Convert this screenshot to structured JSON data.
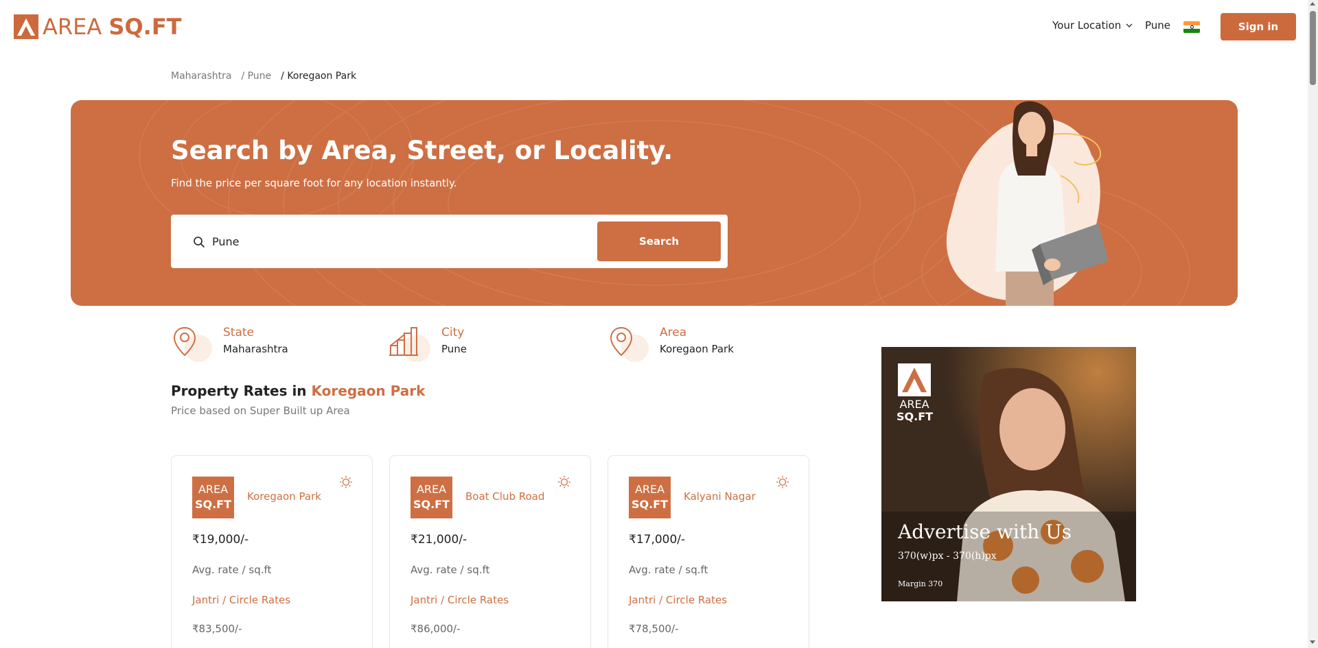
{
  "brand": {
    "name_light": "AREA ",
    "name_bold": "SQ.FT",
    "accent_color": "#cd6f43"
  },
  "header": {
    "location_label": "Your Location",
    "city": "Pune",
    "flag_icon": "india-flag-icon",
    "signin_label": "Sign in"
  },
  "breadcrumb": {
    "items": [
      "Maharashtra",
      "/ Pune",
      "/ Koregaon Park"
    ]
  },
  "hero": {
    "title": "Search by Area, Street, or Locality.",
    "subtitle": "Find the price per square foot for any location instantly.",
    "search_value": "Pune",
    "search_button": "Search"
  },
  "info": [
    {
      "label": "State",
      "value": "Maharashtra",
      "icon": "location-pin-icon"
    },
    {
      "label": "City",
      "value": "Pune",
      "icon": "city-buildings-icon"
    },
    {
      "label": "Area",
      "value": "Koregaon Park",
      "icon": "location-pin-icon"
    }
  ],
  "rates": {
    "title_prefix": "Property Rates in ",
    "title_highlight": "Koregaon Park",
    "subtitle": "Price based on Super Built up Area"
  },
  "cards": [
    {
      "logo_l1": "AREA",
      "logo_l2": "SQ.FT",
      "name": "Koregaon Park",
      "price": "₹19,000/-",
      "avg_label": "Avg. rate / sq.ft",
      "jantri_label": "Jantri / Circle Rates",
      "circle_rate": "₹83,500/-"
    },
    {
      "logo_l1": "AREA",
      "logo_l2": "SQ.FT",
      "name": "Boat Club Road",
      "price": "₹21,000/-",
      "avg_label": "Avg. rate / sq.ft",
      "jantri_label": "Jantri / Circle Rates",
      "circle_rate": "₹86,000/-"
    },
    {
      "logo_l1": "AREA",
      "logo_l2": "SQ.FT",
      "name": "Kalyani Nagar",
      "price": "₹17,000/-",
      "avg_label": "Avg. rate / sq.ft",
      "jantri_label": "Jantri / Circle Rates",
      "circle_rate": "₹78,500/-"
    }
  ],
  "ad": {
    "logo_l1": "AREA",
    "logo_l2": "SQ.FT",
    "title": "Advertise with Us",
    "size": "370(w)px - 370(h)px",
    "margin": "Margin 370"
  }
}
